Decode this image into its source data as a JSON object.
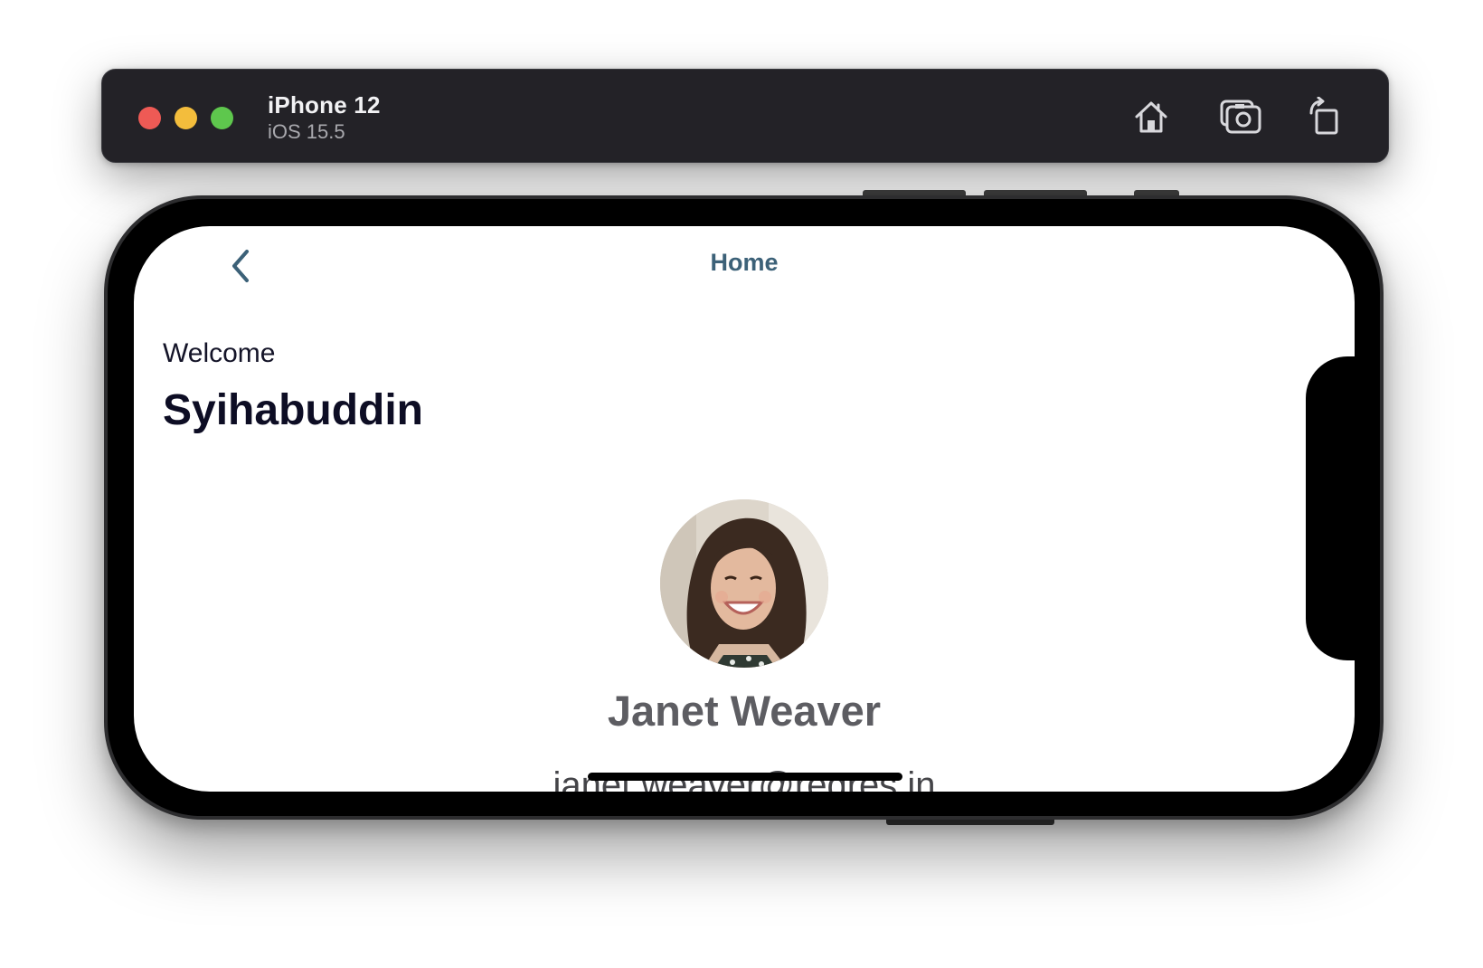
{
  "simulator": {
    "device_name": "iPhone 12",
    "os_version": "iOS 15.5",
    "tools": [
      {
        "icon": "home-icon"
      },
      {
        "icon": "camera-icon"
      },
      {
        "icon": "rotate-icon"
      }
    ]
  },
  "app": {
    "nav": {
      "title": "Home",
      "back_icon": "chevron-left-icon"
    },
    "greeting": {
      "welcome_text": "Welcome",
      "user_name": "Syihabuddin"
    },
    "profile": {
      "name": "Janet Weaver",
      "email": "janet.weaver@reqres.in"
    }
  },
  "colors": {
    "nav_accent": "#3c6178",
    "title_bar": "#232227",
    "close": "#ee5a55",
    "minimize": "#f3bd3c",
    "maximize": "#5ec74d"
  }
}
